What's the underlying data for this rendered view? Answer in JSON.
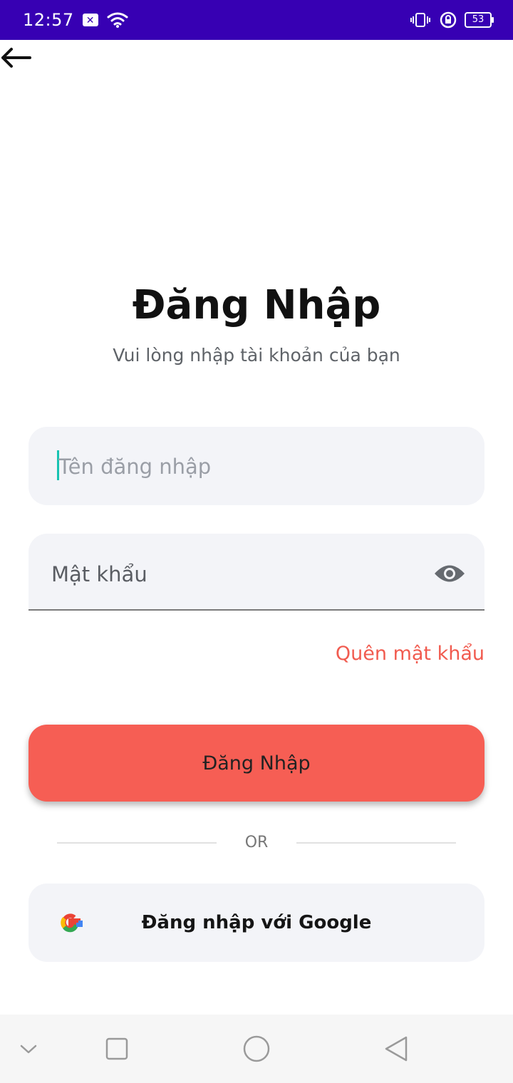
{
  "status_bar": {
    "time": "12:57",
    "notification_badge": "✕",
    "battery": "53",
    "background_color": "#3700b3"
  },
  "login": {
    "title": "Đăng Nhập",
    "subtitle": "Vui lòng nhập tài khoản của bạn",
    "username_placeholder": "Tên đăng nhập",
    "password_label": "Mật khẩu",
    "forgot_password": "Quên mật khẩu",
    "login_button": "Đăng Nhập",
    "divider_text": "OR",
    "google_button": "Đăng nhập với Google"
  },
  "colors": {
    "accent": "#f65e54",
    "link": "#f15b4f",
    "field_background": "#f3f4f8",
    "caret": "#17c3b2"
  },
  "icons": {
    "back": "arrow-left-icon",
    "password_toggle": "eye-icon",
    "google": "google-logo-icon",
    "nav": [
      "chevron-down-icon",
      "square-icon",
      "circle-icon",
      "triangle-back-icon"
    ]
  }
}
